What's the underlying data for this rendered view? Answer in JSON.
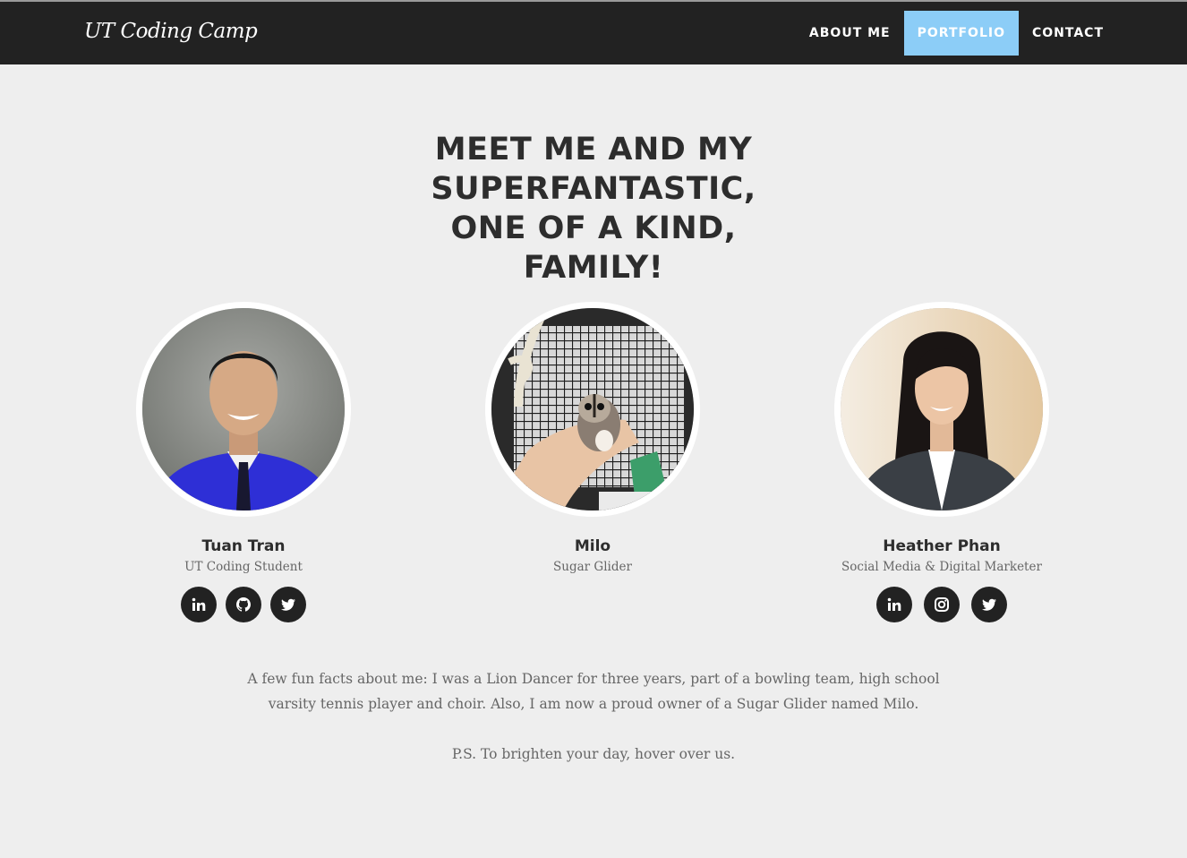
{
  "navbar": {
    "brand": "UT Coding Camp",
    "links": [
      {
        "label": "ABOUT ME",
        "active": false
      },
      {
        "label": "PORTFOLIO",
        "active": true
      },
      {
        "label": "CONTACT",
        "active": false
      }
    ]
  },
  "headline": {
    "line1": "MEET ME AND MY",
    "line2": "SUPERFANTASTIC,",
    "line3": "ONE OF A KIND,",
    "line4": "FAMILY!"
  },
  "people": [
    {
      "name": "Tuan Tran",
      "role": "UT Coding Student",
      "socials": [
        "linkedin-icon",
        "github-icon",
        "twitter-icon"
      ]
    },
    {
      "name": "Milo",
      "role": "Sugar Glider",
      "socials": []
    },
    {
      "name": "Heather Phan",
      "role": "Social Media & Digital Marketer",
      "socials": [
        "linkedin-icon",
        "instagram-icon",
        "twitter-icon"
      ]
    }
  ],
  "about": {
    "line1": "A few fun facts about me: I was a Lion Dancer for three years, part of a bowling team, high school",
    "line2": "varsity tennis player and choir. Also, I am now a proud owner of a Sugar Glider named Milo.",
    "ps": "P.S. To brighten your day, hover over us."
  },
  "colors": {
    "navbar_bg": "#222222",
    "active_nav": "#8ccdf7",
    "page_bg": "#eeeeee",
    "heading": "#2d2d2d",
    "body_text": "#666666"
  }
}
